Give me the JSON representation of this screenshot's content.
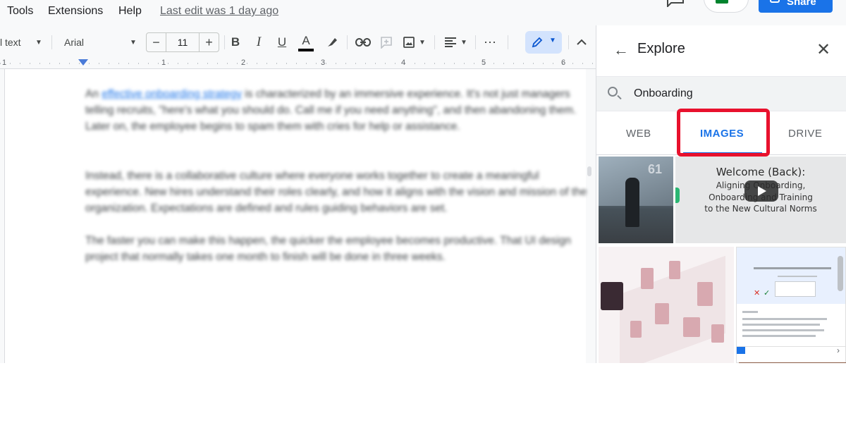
{
  "menu": {
    "items": [
      "Tools",
      "Extensions",
      "Help"
    ],
    "last_edit": "Last edit was 1 day ago"
  },
  "header": {
    "share_label": "Share"
  },
  "toolbar": {
    "style_label": "l text",
    "font_label": "Arial",
    "font_size": "11",
    "minus": "−",
    "plus": "+",
    "bold": "B",
    "italic": "I",
    "underline": "U",
    "text_color": "A",
    "more": "⋯"
  },
  "ruler": {
    "numbers": [
      "1",
      "1",
      "2",
      "3",
      "4",
      "5",
      "6"
    ]
  },
  "document": {
    "paragraphs": [
      {
        "link_prefix": "An ",
        "link": "effective onboarding strategy",
        "text": " is characterized by an immersive experience. It's not just managers telling recruits, \"here's what you should do. Call me if you need anything\", and then abandoning them. Later on, the employee begins to spam them with cries for help or assistance."
      },
      {
        "text": "Instead, there is a collaborative culture where everyone works together to create a meaningful experience. New hires understand their roles clearly, and how it aligns with the vision and mission of the organization. Expectations are defined and rules guiding behaviors are set."
      },
      {
        "text": "The faster you can make this happen, the quicker the employee becomes productive. That UI design project that normally takes one month to finish will be done in three weeks."
      }
    ]
  },
  "explore": {
    "title": "Explore",
    "search_query": "Onboarding",
    "tabs": [
      {
        "label": "WEB",
        "active": false
      },
      {
        "label": "IMAGES",
        "active": true
      },
      {
        "label": "DRIVE",
        "active": false
      }
    ],
    "image2": {
      "title": "Welcome (Back):",
      "lines": [
        "Aligning Onboarding,",
        "Onboarding and Training",
        "to the New Cultural Norms"
      ]
    },
    "image1_number": "61"
  },
  "colors": {
    "accent": "#1a73e8",
    "highlight_box": "#e8112d",
    "panel_bg": "#f8f9fa"
  },
  "icons": [
    "arrow-back-icon",
    "close-icon",
    "search-icon",
    "link-icon",
    "comment-icon",
    "image-icon",
    "align-icon",
    "edit-pencil-icon",
    "chevron-up-icon",
    "highlighter-icon",
    "chat-icon",
    "meet-icon",
    "lock-icon"
  ]
}
